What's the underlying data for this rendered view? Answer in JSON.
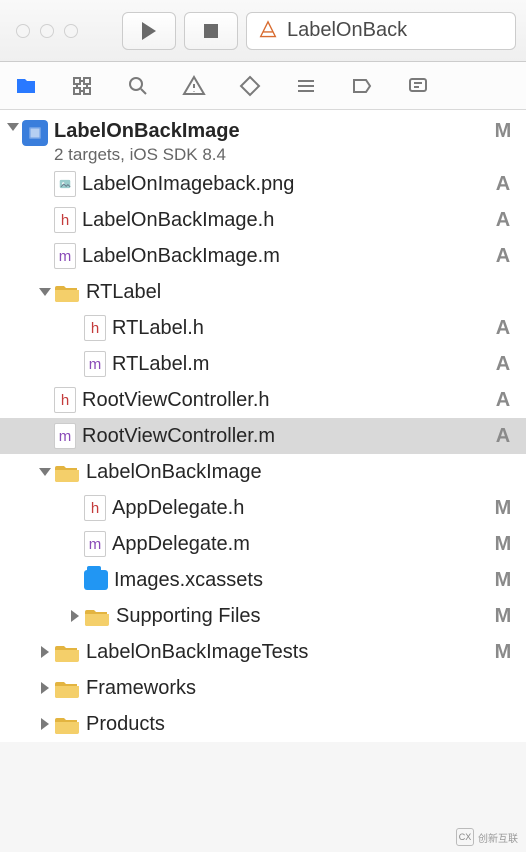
{
  "toolbar": {
    "scheme_label": "LabelOnBack"
  },
  "project": {
    "name": "LabelOnBackImage",
    "subtitle": "2 targets, iOS SDK 8.4",
    "status": "M"
  },
  "tree": [
    {
      "depth": 1,
      "disclosure": "none",
      "icon": "png",
      "label": "LabelOnImageback.png",
      "status": "A",
      "selected": false
    },
    {
      "depth": 1,
      "disclosure": "none",
      "icon": "h",
      "label": "LabelOnBackImage.h",
      "status": "A",
      "selected": false
    },
    {
      "depth": 1,
      "disclosure": "none",
      "icon": "m",
      "label": "LabelOnBackImage.m",
      "status": "A",
      "selected": false
    },
    {
      "depth": 1,
      "disclosure": "down",
      "icon": "folder",
      "label": "RTLabel",
      "status": "",
      "selected": false
    },
    {
      "depth": 2,
      "disclosure": "none",
      "icon": "h",
      "label": "RTLabel.h",
      "status": "A",
      "selected": false
    },
    {
      "depth": 2,
      "disclosure": "none",
      "icon": "m",
      "label": "RTLabel.m",
      "status": "A",
      "selected": false
    },
    {
      "depth": 1,
      "disclosure": "none",
      "icon": "h",
      "label": "RootViewController.h",
      "status": "A",
      "selected": false
    },
    {
      "depth": 1,
      "disclosure": "none",
      "icon": "m",
      "label": "RootViewController.m",
      "status": "A",
      "selected": true
    },
    {
      "depth": 1,
      "disclosure": "down",
      "icon": "folder",
      "label": "LabelOnBackImage",
      "status": "",
      "selected": false
    },
    {
      "depth": 2,
      "disclosure": "none",
      "icon": "h",
      "label": "AppDelegate.h",
      "status": "M",
      "selected": false
    },
    {
      "depth": 2,
      "disclosure": "none",
      "icon": "m",
      "label": "AppDelegate.m",
      "status": "M",
      "selected": false
    },
    {
      "depth": 2,
      "disclosure": "none",
      "icon": "assets",
      "label": "Images.xcassets",
      "status": "M",
      "selected": false
    },
    {
      "depth": 2,
      "disclosure": "right",
      "icon": "folder",
      "label": "Supporting Files",
      "status": "M",
      "selected": false
    },
    {
      "depth": 1,
      "disclosure": "right",
      "icon": "folder",
      "label": "LabelOnBackImageTests",
      "status": "M",
      "selected": false
    },
    {
      "depth": 1,
      "disclosure": "right",
      "icon": "folder",
      "label": "Frameworks",
      "status": "",
      "selected": false
    },
    {
      "depth": 1,
      "disclosure": "right",
      "icon": "folder",
      "label": "Products",
      "status": "",
      "selected": false
    }
  ],
  "watermark": {
    "text": "创新互联"
  }
}
